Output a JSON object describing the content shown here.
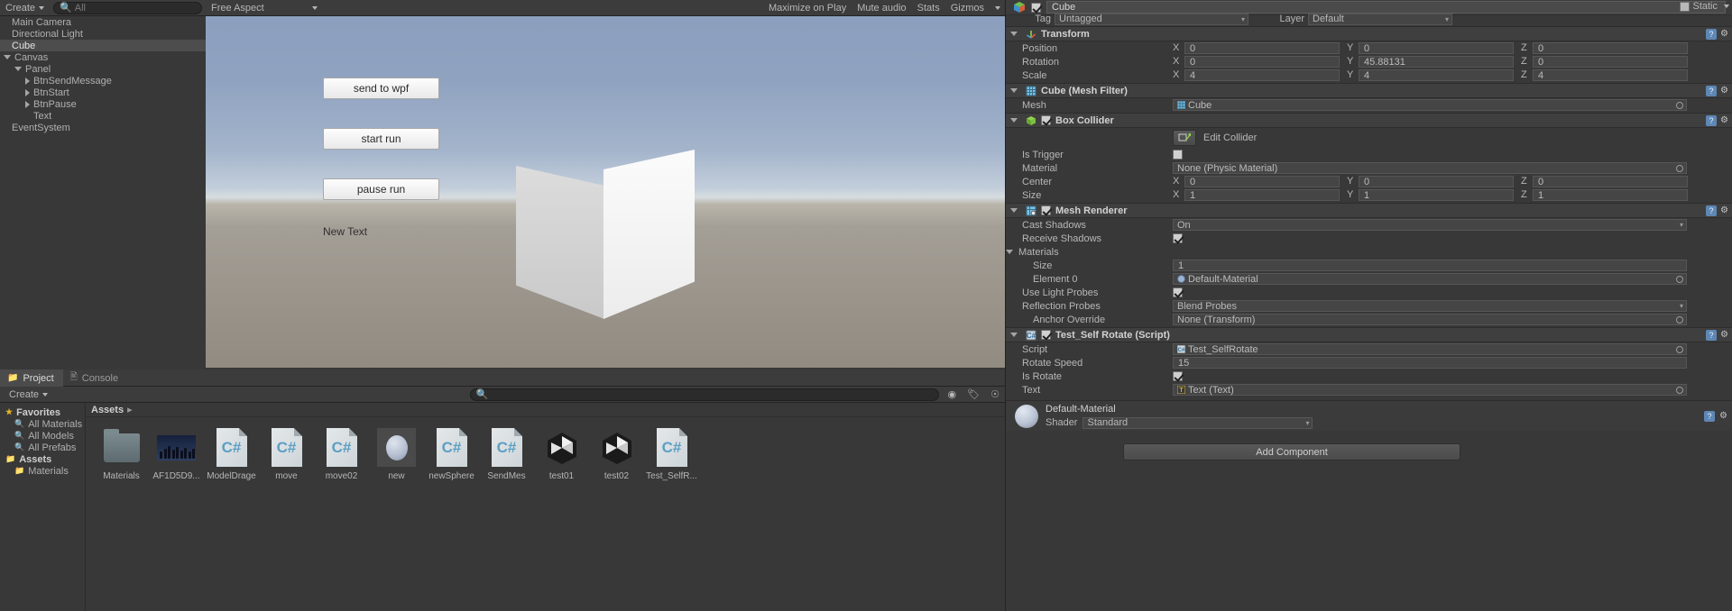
{
  "hierarchy": {
    "create_label": "Create",
    "search_placeholder": "All",
    "items": [
      {
        "label": "Main Camera",
        "indent": 0,
        "arrow": "none",
        "selected": false
      },
      {
        "label": "Directional Light",
        "indent": 0,
        "arrow": "none",
        "selected": false
      },
      {
        "label": "Cube",
        "indent": 0,
        "arrow": "none",
        "selected": true
      },
      {
        "label": "Canvas",
        "indent": 0,
        "arrow": "open",
        "selected": false
      },
      {
        "label": "Panel",
        "indent": 1,
        "arrow": "open",
        "selected": false
      },
      {
        "label": "BtnSendMessage",
        "indent": 2,
        "arrow": "closed",
        "selected": false
      },
      {
        "label": "BtnStart",
        "indent": 2,
        "arrow": "closed",
        "selected": false
      },
      {
        "label": "BtnPause",
        "indent": 2,
        "arrow": "closed",
        "selected": false
      },
      {
        "label": "Text",
        "indent": 2,
        "arrow": "none",
        "selected": false
      },
      {
        "label": "EventSystem",
        "indent": 0,
        "arrow": "none",
        "selected": false
      }
    ]
  },
  "game_view": {
    "aspect_label": "Free Aspect",
    "maximize_label": "Maximize on Play",
    "mute_label": "Mute audio",
    "stats_label": "Stats",
    "gizmos_label": "Gizmos",
    "buttons": [
      {
        "label": "send to wpf"
      },
      {
        "label": "start run"
      },
      {
        "label": "pause run"
      }
    ],
    "text_label": "New Text"
  },
  "project": {
    "tabs": [
      {
        "label": "Project",
        "icon": "folder-icon",
        "active": true
      },
      {
        "label": "Console",
        "icon": "console-icon",
        "active": false
      }
    ],
    "create_label": "Create",
    "search_placeholder": "",
    "tree": [
      {
        "label": "Favorites",
        "icon": "star-icon",
        "indent": 0,
        "bold": true
      },
      {
        "label": "All Materials",
        "icon": "search-icon",
        "indent": 1,
        "bold": false
      },
      {
        "label": "All Models",
        "icon": "search-icon",
        "indent": 1,
        "bold": false
      },
      {
        "label": "All Prefabs",
        "icon": "search-icon",
        "indent": 1,
        "bold": false
      },
      {
        "label": "Assets",
        "icon": "folder-icon",
        "indent": 0,
        "bold": true
      },
      {
        "label": "Materials",
        "icon": "folder-icon",
        "indent": 1,
        "bold": false
      }
    ],
    "breadcrumb": "Assets",
    "assets": [
      {
        "label": "Materials",
        "type": "folder"
      },
      {
        "label": "AF1D5D9...",
        "type": "image"
      },
      {
        "label": "ModelDrage",
        "type": "csharp"
      },
      {
        "label": "move",
        "type": "csharp"
      },
      {
        "label": "move02",
        "type": "csharp"
      },
      {
        "label": "new",
        "type": "material"
      },
      {
        "label": "newSphere",
        "type": "csharp"
      },
      {
        "label": "SendMes",
        "type": "csharp"
      },
      {
        "label": "test01",
        "type": "unity-scene"
      },
      {
        "label": "test02",
        "type": "unity-scene"
      },
      {
        "label": "Test_SelfR...",
        "type": "csharp"
      }
    ]
  },
  "inspector": {
    "object_name": "Cube",
    "object_enabled": true,
    "static_label": "Static",
    "tag_label": "Tag",
    "tag_value": "Untagged",
    "layer_label": "Layer",
    "layer_value": "Default",
    "components": [
      {
        "name": "Transform",
        "icon": "transform-icon",
        "has_checkbox": false,
        "rows": [
          {
            "label": "Position",
            "kind": "vector3",
            "x": "0",
            "y": "0",
            "z": "0"
          },
          {
            "label": "Rotation",
            "kind": "vector3",
            "x": "0",
            "y": "45.88131",
            "z": "0"
          },
          {
            "label": "Scale",
            "kind": "vector3",
            "x": "4",
            "y": "4",
            "z": "4"
          }
        ]
      },
      {
        "name": "Cube (Mesh Filter)",
        "icon": "mesh-filter-icon",
        "has_checkbox": false,
        "rows": [
          {
            "label": "Mesh",
            "kind": "object",
            "value": "Cube",
            "icon": "mesh-icon"
          }
        ]
      },
      {
        "name": "Box Collider",
        "icon": "box-collider-icon",
        "has_checkbox": true,
        "checked": true,
        "rows": [
          {
            "label": "",
            "kind": "edit-collider",
            "value": "Edit Collider"
          },
          {
            "label": "Is Trigger",
            "kind": "checkbox",
            "checked": false
          },
          {
            "label": "Material",
            "kind": "object",
            "value": "None (Physic Material)",
            "icon": "none-icon"
          },
          {
            "label": "Center",
            "kind": "vector3",
            "x": "0",
            "y": "0",
            "z": "0"
          },
          {
            "label": "Size",
            "kind": "vector3",
            "x": "1",
            "y": "1",
            "z": "1"
          }
        ]
      },
      {
        "name": "Mesh Renderer",
        "icon": "mesh-renderer-icon",
        "has_checkbox": true,
        "checked": true,
        "rows": [
          {
            "label": "Cast Shadows",
            "kind": "dropdown",
            "value": "On"
          },
          {
            "label": "Receive Shadows",
            "kind": "checkbox",
            "checked": true
          },
          {
            "label": "Materials",
            "kind": "foldout",
            "value": ""
          },
          {
            "label": "Size",
            "kind": "number",
            "value": "1",
            "indent": 1
          },
          {
            "label": "Element 0",
            "kind": "object",
            "value": "Default-Material",
            "icon": "material-icon",
            "indent": 1
          },
          {
            "label": "Use Light Probes",
            "kind": "checkbox",
            "checked": true
          },
          {
            "label": "Reflection Probes",
            "kind": "dropdown",
            "value": "Blend Probes"
          },
          {
            "label": "Anchor Override",
            "kind": "object",
            "value": "None (Transform)",
            "icon": "none-icon",
            "indent": 1
          }
        ]
      },
      {
        "name": "Test_Self Rotate (Script)",
        "icon": "script-icon",
        "has_checkbox": true,
        "checked": true,
        "rows": [
          {
            "label": "Script",
            "kind": "object",
            "value": "Test_SelfRotate",
            "icon": "script-file-icon"
          },
          {
            "label": "Rotate Speed",
            "kind": "number",
            "value": "15"
          },
          {
            "label": "Is Rotate",
            "kind": "checkbox",
            "checked": true
          },
          {
            "label": "Text",
            "kind": "object",
            "value": "Text (Text)",
            "icon": "text-icon"
          }
        ]
      }
    ],
    "material_preview": {
      "title": "Default-Material",
      "shader_label": "Shader",
      "shader_value": "Standard"
    },
    "add_component_label": "Add Component"
  }
}
